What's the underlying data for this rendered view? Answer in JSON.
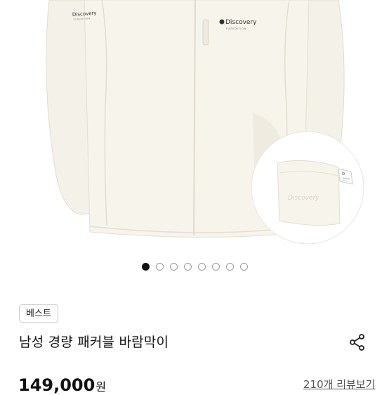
{
  "product": {
    "brand_logo": "Discovery",
    "brand_sub": "EXPEDITION",
    "pouch_logo": "Discovery",
    "image_count": 8,
    "active_image_index": 1,
    "badge": "베스트",
    "title": "남성 경량 패커블 바람막이",
    "price": "149,000",
    "price_unit": "원",
    "review_link": "210개 리뷰보기"
  },
  "icons": {
    "share": "share-icon"
  },
  "colors": {
    "jacket": "#f6f3ea",
    "jacket_shadow": "#e6e1d4",
    "active_dot": "#111111"
  }
}
